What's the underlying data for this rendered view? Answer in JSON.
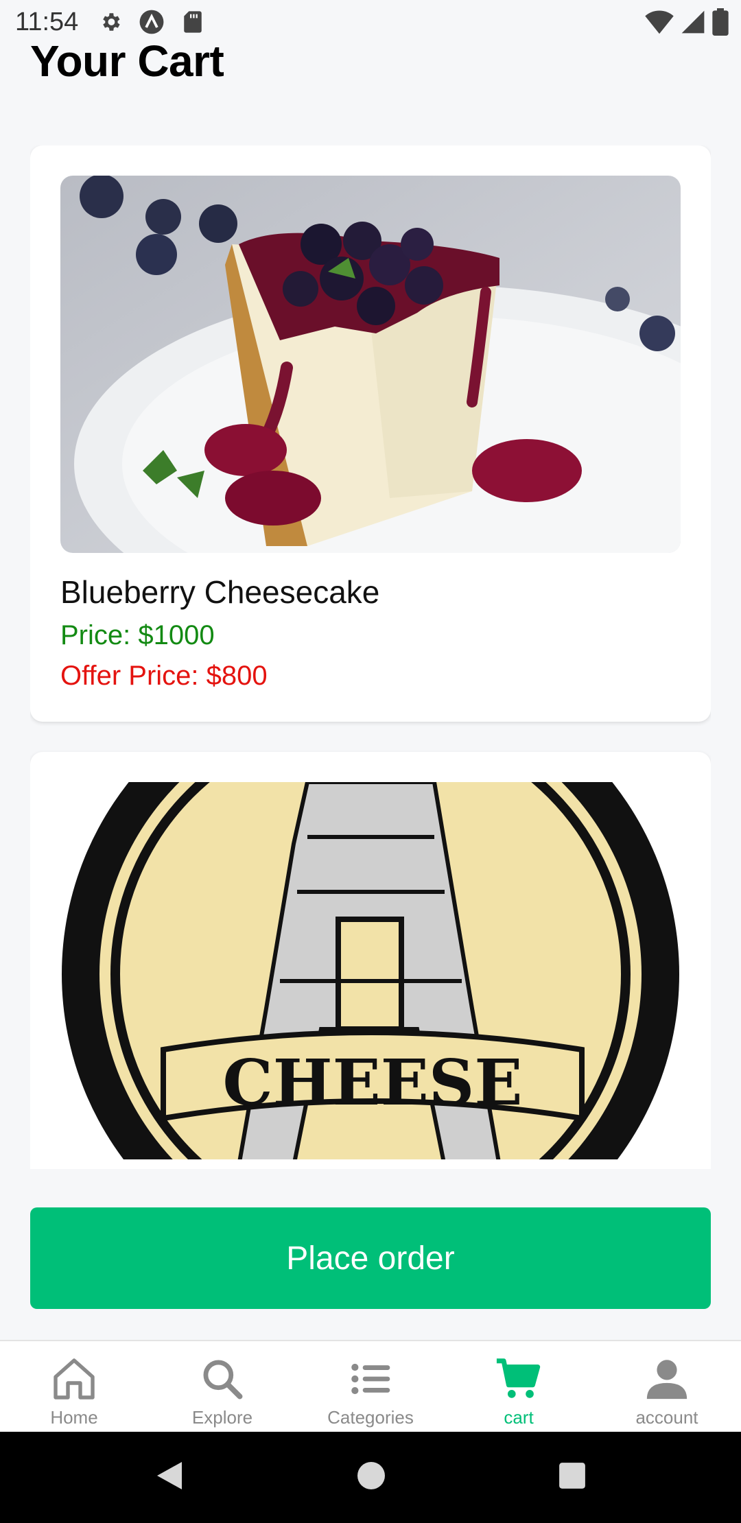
{
  "status_bar": {
    "time": "11:54",
    "left_icons": [
      "gear-icon",
      "a-icon",
      "sd-card-icon"
    ],
    "right_icons": [
      "wifi-icon",
      "signal-icon",
      "battery-icon"
    ]
  },
  "header": {
    "title": "Your Cart"
  },
  "cart": {
    "items": [
      {
        "image": "blueberry-cheesecake-photo",
        "name": "Blueberry Cheesecake",
        "price": "Price: $1000",
        "offer_price": "Offer Price: $800"
      },
      {
        "image": "paris-cheese-logo",
        "logo_text": "CHEESE"
      }
    ]
  },
  "actions": {
    "place_order": "Place order"
  },
  "bottom_nav": {
    "items": [
      {
        "label": "Home",
        "icon": "home-icon"
      },
      {
        "label": "Explore",
        "icon": "search-icon"
      },
      {
        "label": "Categories",
        "icon": "list-icon"
      },
      {
        "label": "cart",
        "icon": "cart-icon",
        "active": true
      },
      {
        "label": "account",
        "icon": "person-icon"
      }
    ]
  },
  "colors": {
    "accent": "#00bf78",
    "price": "#138a13",
    "offer_price": "#e4130f",
    "background": "#f6f7f9"
  }
}
